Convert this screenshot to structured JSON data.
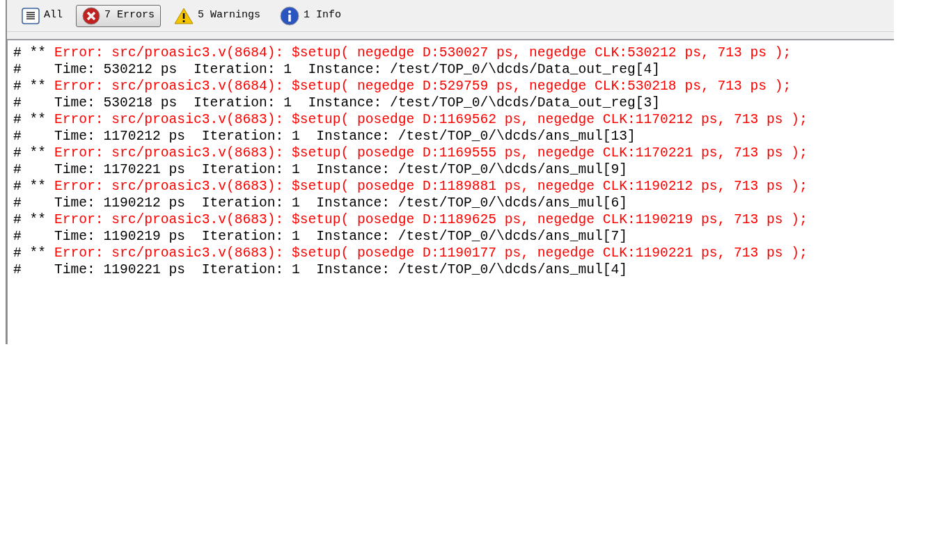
{
  "filters": [
    {
      "kind": "all",
      "label": "All",
      "selected": false
    },
    {
      "kind": "error",
      "label": "7 Errors",
      "selected": true
    },
    {
      "kind": "warning",
      "label": "5 Warnings",
      "selected": false
    },
    {
      "kind": "info",
      "label": "1 Info",
      "selected": false
    }
  ],
  "log": [
    {
      "kind": "error",
      "prefix": "# **",
      "text": "Error: src/proasic3.v(8684): $setup( negedge D:530027 ps, negedge CLK:530212 ps, 713 ps );"
    },
    {
      "kind": "note",
      "prefix": "#",
      "text": "Time: 530212 ps  Iteration: 1  Instance: /test/TOP_0/\\dcds/Data_out_reg[4]"
    },
    {
      "kind": "error",
      "prefix": "# **",
      "text": "Error: src/proasic3.v(8684): $setup( negedge D:529759 ps, negedge CLK:530218 ps, 713 ps );"
    },
    {
      "kind": "note",
      "prefix": "#",
      "text": "Time: 530218 ps  Iteration: 1  Instance: /test/TOP_0/\\dcds/Data_out_reg[3]"
    },
    {
      "kind": "error",
      "prefix": "# **",
      "text": "Error: src/proasic3.v(8683): $setup( posedge D:1169562 ps, negedge CLK:1170212 ps, 713 ps );"
    },
    {
      "kind": "note",
      "prefix": "#",
      "text": "Time: 1170212 ps  Iteration: 1  Instance: /test/TOP_0/\\dcds/ans_mul[13]"
    },
    {
      "kind": "error",
      "prefix": "# **",
      "text": "Error: src/proasic3.v(8683): $setup( posedge D:1169555 ps, negedge CLK:1170221 ps, 713 ps );"
    },
    {
      "kind": "note",
      "prefix": "#",
      "text": "Time: 1170221 ps  Iteration: 1  Instance: /test/TOP_0/\\dcds/ans_mul[9]"
    },
    {
      "kind": "error",
      "prefix": "# **",
      "text": "Error: src/proasic3.v(8683): $setup( posedge D:1189881 ps, negedge CLK:1190212 ps, 713 ps );"
    },
    {
      "kind": "note",
      "prefix": "#",
      "text": "Time: 1190212 ps  Iteration: 1  Instance: /test/TOP_0/\\dcds/ans_mul[6]"
    },
    {
      "kind": "error",
      "prefix": "# **",
      "text": "Error: src/proasic3.v(8683): $setup( posedge D:1189625 ps, negedge CLK:1190219 ps, 713 ps );"
    },
    {
      "kind": "note",
      "prefix": "#",
      "text": "Time: 1190219 ps  Iteration: 1  Instance: /test/TOP_0/\\dcds/ans_mul[7]"
    },
    {
      "kind": "error",
      "prefix": "# **",
      "text": "Error: src/proasic3.v(8683): $setup( posedge D:1190177 ps, negedge CLK:1190221 ps, 713 ps );"
    },
    {
      "kind": "note",
      "prefix": "#",
      "text": "Time: 1190221 ps  Iteration: 1  Instance: /test/TOP_0/\\dcds/ans_mul[4]"
    }
  ]
}
